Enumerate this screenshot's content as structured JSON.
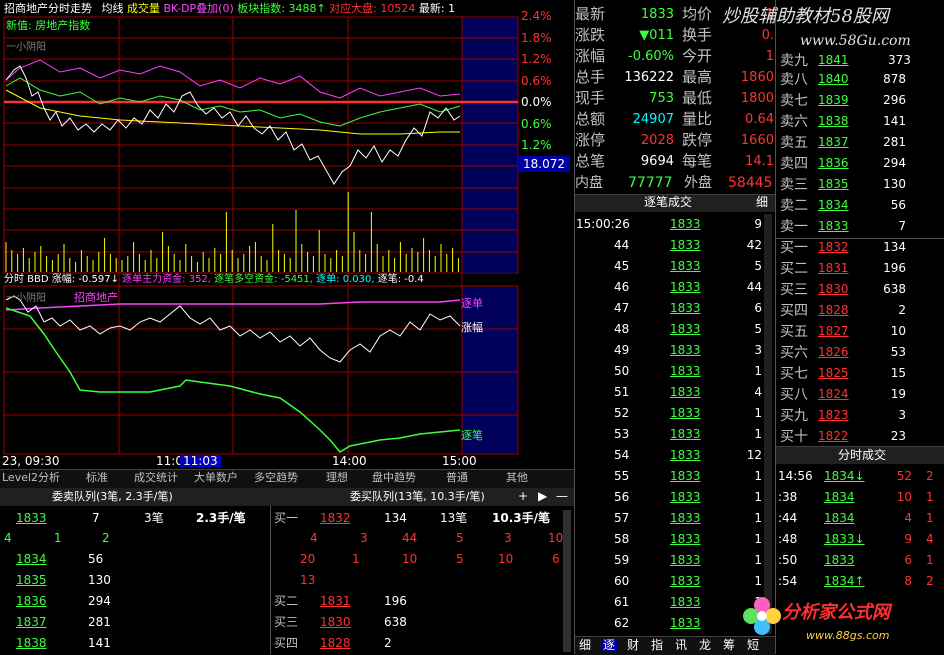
{
  "chart_header": {
    "title": "招商地产分时走势",
    "avg_label": "均线",
    "vol_label": "成交量",
    "overlay": "BK-DP叠加(0)",
    "sector_index": "板块指数: 3488↑",
    "corr_label": "对应大盘: 10524",
    "latest_label": "最新: 1"
  },
  "sector_line": "新值: 房地产指数",
  "small_label": "一小阴阳",
  "pct_labels_red": [
    "2.4%",
    "1.8%",
    "1.2%",
    "0.6%"
  ],
  "pct_zero": "0.0%",
  "pct_labels_green": [
    "0.6%",
    "1.2%"
  ],
  "price_box": "18.072",
  "sub_header": {
    "label": "分时 BBD",
    "zhangfu": "涨幅: -0.597↓",
    "main_funds": "逐单主力资金: 352,",
    "multi_empty": "逐笔多空资金: -5451,",
    "zhudan": "逐单: 0.030,",
    "zhubi": "逐笔: -0.4"
  },
  "sub_legend": "招商地产",
  "sub_small": "一小阴阳",
  "sub_tags": {
    "zhudan": "逐单",
    "zhangfu": "涨幅",
    "zhubi": "逐笔"
  },
  "time_axis": {
    "left": "23, 09:30",
    "mid1": "11:0",
    "cursor": "11:03",
    "mid2": "14:00",
    "right": "15:00"
  },
  "bottom_tabs": [
    "Level2分析",
    "标准",
    "成交统计",
    "大单数户",
    "多空趋势",
    "理想",
    "盘中趋势",
    "普通",
    "其他"
  ],
  "sell_queue_title": "委卖队列(3笔, 2.3手/笔)",
  "buy_queue_title": "委买队列(13笔, 10.3手/笔)",
  "queue_ctrl": [
    "+",
    "▶",
    "—"
  ],
  "sell_queue": {
    "price": "1833",
    "count": "7",
    "bi": "3笔",
    "avg": "2.3手/笔",
    "detail": [
      "4",
      "1",
      "2"
    ],
    "rows": [
      {
        "p": "1834",
        "v": "56"
      },
      {
        "p": "1835",
        "v": "130"
      },
      {
        "p": "1836",
        "v": "294"
      },
      {
        "p": "1837",
        "v": "281"
      },
      {
        "p": "1838",
        "v": "141"
      }
    ]
  },
  "buy_queue": {
    "label": "买一",
    "price": "1832",
    "count": "134",
    "bi": "13笔",
    "avg": "10.3手/笔",
    "detail1": [
      "4",
      "3",
      "44",
      "5",
      "3",
      "10"
    ],
    "detail2": [
      "20",
      "1",
      "10",
      "5",
      "10",
      "6"
    ],
    "detail3": [
      "13"
    ],
    "rows": [
      {
        "l": "买二",
        "p": "1831",
        "v": "196"
      },
      {
        "l": "买三",
        "p": "1830",
        "v": "638"
      },
      {
        "l": "买四",
        "p": "1828",
        "v": "2"
      }
    ]
  },
  "quote": [
    {
      "l1": "最新",
      "v1": "1833",
      "c1": "green",
      "l2": "均价",
      "v2": "1"
    },
    {
      "l1": "涨跌",
      "v1": "▼011",
      "c1": "green",
      "l2": "换手",
      "v2": "0."
    },
    {
      "l1": "涨幅",
      "v1": "-0.60%",
      "c1": "green",
      "l2": "今开",
      "v2": "1"
    },
    {
      "l1": "总手",
      "v1": "136222",
      "c1": "white",
      "l2": "最高",
      "v2": "1860"
    },
    {
      "l1": "现手",
      "v1": "753",
      "c1": "green",
      "l2": "最低",
      "v2": "1800"
    },
    {
      "l1": "总额",
      "v1": "24907",
      "c1": "cyan",
      "l2": "量比",
      "v2": "0.64"
    },
    {
      "l1": "涨停",
      "v1": "2028",
      "c1": "red",
      "l2": "跌停",
      "v2": "1660"
    },
    {
      "l1": "总笔",
      "v1": "9694",
      "c1": "white",
      "l2": "每笔",
      "v2": "14.1"
    }
  ],
  "inner_outer": {
    "l1": "内盘",
    "v1": "77777",
    "l2": "外盘",
    "v2": "58445"
  },
  "watermark_top": "炒股辅助教材58股网",
  "watermark_url": "www.58Gu.com",
  "watermark_bottom": "分析家公式网",
  "watermark_bottom_url": "www.88gs.com",
  "order_book_sell": [
    {
      "l": "卖八",
      "p": "1840",
      "v": "878"
    },
    {
      "l": "卖七",
      "p": "1839",
      "v": "296"
    },
    {
      "l": "卖六",
      "p": "1838",
      "v": "141"
    },
    {
      "l": "卖五",
      "p": "1837",
      "v": "281"
    },
    {
      "l": "卖四",
      "p": "1836",
      "v": "294"
    },
    {
      "l": "卖三",
      "p": "1835",
      "v": "130"
    },
    {
      "l": "卖二",
      "p": "1834",
      "v": "56"
    },
    {
      "l": "卖一",
      "p": "1833",
      "v": "7"
    }
  ],
  "order_book_sell_top": {
    "l": "卖九",
    "p": "1841",
    "v": "373"
  },
  "order_book_buy": [
    {
      "l": "买一",
      "p": "1832",
      "v": "134"
    },
    {
      "l": "买二",
      "p": "1831",
      "v": "196"
    },
    {
      "l": "买三",
      "p": "1830",
      "v": "638"
    },
    {
      "l": "买四",
      "p": "1828",
      "v": "2"
    },
    {
      "l": "买五",
      "p": "1827",
      "v": "10"
    },
    {
      "l": "买六",
      "p": "1826",
      "v": "53"
    },
    {
      "l": "买七",
      "p": "1825",
      "v": "15"
    },
    {
      "l": "买八",
      "p": "1824",
      "v": "19"
    },
    {
      "l": "买九",
      "p": "1823",
      "v": "3"
    },
    {
      "l": "买十",
      "p": "1822",
      "v": "23"
    }
  ],
  "tick_panel": {
    "title": "逐笔成交",
    "detail": "细",
    "first_time": "15:00:26",
    "rows": [
      {
        "s": "",
        "p": "1833",
        "v": "9"
      },
      {
        "s": "44",
        "p": "1833",
        "v": "42"
      },
      {
        "s": "45",
        "p": "1833",
        "v": "5"
      },
      {
        "s": "46",
        "p": "1833",
        "v": "44"
      },
      {
        "s": "47",
        "p": "1833",
        "v": "6"
      },
      {
        "s": "48",
        "p": "1833",
        "v": "5"
      },
      {
        "s": "49",
        "p": "1833",
        "v": "3"
      },
      {
        "s": "50",
        "p": "1833",
        "v": "1"
      },
      {
        "s": "51",
        "p": "1833",
        "v": "4"
      },
      {
        "s": "52",
        "p": "1833",
        "v": "1"
      },
      {
        "s": "53",
        "p": "1833",
        "v": "1"
      },
      {
        "s": "54",
        "p": "1833",
        "v": "12"
      },
      {
        "s": "55",
        "p": "1833",
        "v": "1"
      },
      {
        "s": "56",
        "p": "1833",
        "v": "1"
      },
      {
        "s": "57",
        "p": "1833",
        "v": "1"
      },
      {
        "s": "58",
        "p": "1833",
        "v": "1"
      },
      {
        "s": "59",
        "p": "1833",
        "v": "1"
      },
      {
        "s": "60",
        "p": "1833",
        "v": "1"
      },
      {
        "s": "61",
        "p": "1833",
        "v": "1"
      },
      {
        "s": "62",
        "p": "1833",
        "v": "1"
      }
    ],
    "bottom_tabs": [
      "细",
      "逐",
      "财",
      "指",
      "讯",
      "龙",
      "筹",
      "短"
    ]
  },
  "minute_panel": {
    "title": "分时成交",
    "rows": [
      {
        "t": "14:56",
        "p": "1834↓",
        "v": "52",
        "n": "2"
      },
      {
        "t": ":38",
        "p": "1834",
        "v": "10",
        "n": "1"
      },
      {
        "t": ":44",
        "p": "1834",
        "v": "4",
        "n": "1"
      },
      {
        "t": ":48",
        "p": "1833↓",
        "v": "9",
        "n": "4"
      },
      {
        "t": ":50",
        "p": "1833",
        "v": "6",
        "n": "1"
      },
      {
        "t": ":54",
        "p": "1834↑",
        "v": "8",
        "n": "2"
      }
    ]
  }
}
